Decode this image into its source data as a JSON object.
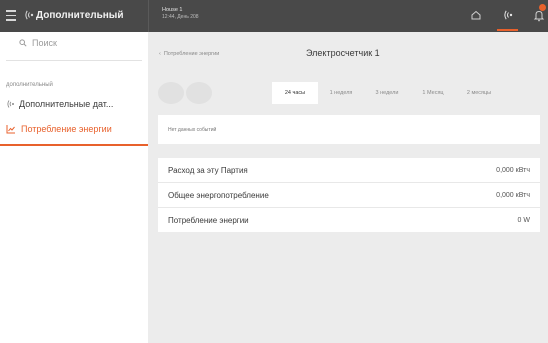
{
  "topbar": {
    "app_title": "Дополнительный",
    "house_name": "House 1",
    "date_time": "12:44, День 208",
    "colors": {
      "bar": "#494949",
      "accent": "#e8612c"
    }
  },
  "sidebar": {
    "search_placeholder": "Поиск",
    "group_label": "дополнительный",
    "items": [
      {
        "label": "Дополнительные дат...",
        "icon": "wireless-icon"
      },
      {
        "label": "Потребление энергии",
        "icon": "chart-icon",
        "active": true
      }
    ]
  },
  "main": {
    "breadcrumb": "Потребление энергии",
    "title": "Электросчетчик 1",
    "tabs": [
      {
        "label": "24 часы",
        "active": true
      },
      {
        "label": "1 неделя"
      },
      {
        "label": "3 недели"
      },
      {
        "label": "1 Месяц"
      },
      {
        "label": "2 месяцы"
      }
    ],
    "no_events": "Нет данных событий",
    "stats": [
      {
        "label": "Расход за эту Партия",
        "value": "0,000 кВтч"
      },
      {
        "label": "Общее энергопотребление",
        "value": "0,000 кВтч"
      },
      {
        "label": "Потребление энергии",
        "value": "0 W"
      }
    ]
  }
}
